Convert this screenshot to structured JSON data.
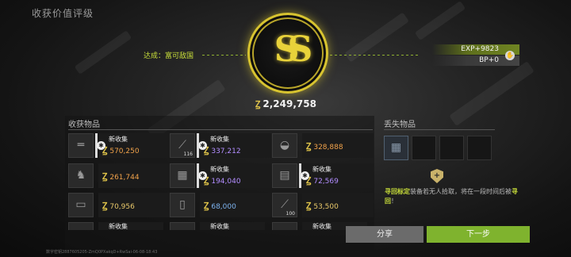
{
  "title": "收获价值评级",
  "achievement": {
    "label": "达成：富可敌国"
  },
  "emblem": {
    "letters": "SS"
  },
  "total_value": "2,249,758",
  "exp": {
    "exp_text": "EXP+9823",
    "bp_text": "BP+0"
  },
  "collected": {
    "title": "收获物品",
    "items": [
      {
        "icon": "rifle-icon",
        "glyph": "═",
        "count": "",
        "tag": "新收集",
        "value": "570,250",
        "quality": "orange",
        "gear": true
      },
      {
        "icon": "spear-icon",
        "glyph": "⟋",
        "count": "116",
        "tag": "新收集",
        "value": "337,212",
        "quality": "purple",
        "gear": true
      },
      {
        "icon": "golden-helmet-icon",
        "glyph": "◒",
        "count": "",
        "tag": "",
        "value": "328,888",
        "quality": "orange",
        "gear": false
      },
      {
        "icon": "golden-rabbit-icon",
        "glyph": "♞",
        "count": "",
        "tag": "",
        "value": "261,744",
        "quality": "orange",
        "gear": false
      },
      {
        "icon": "armor-vest-icon",
        "glyph": "▦",
        "count": "",
        "tag": "新收集",
        "value": "194,040",
        "quality": "purple",
        "gear": true
      },
      {
        "icon": "chest-rig-icon",
        "glyph": "▤",
        "count": "",
        "tag": "新收集",
        "value": "72,569",
        "quality": "purple",
        "gear": true
      },
      {
        "icon": "ammo-box-icon",
        "glyph": "▭",
        "count": "",
        "tag": "",
        "value": "70,956",
        "quality": "gold",
        "gear": false
      },
      {
        "icon": "document-icon",
        "glyph": "▯",
        "count": "",
        "tag": "",
        "value": "68,000",
        "quality": "blue",
        "gear": false
      },
      {
        "icon": "knife-icon",
        "glyph": "⟋",
        "count": "100",
        "tag": "",
        "value": "53,500",
        "quality": "gold",
        "gear": false
      }
    ],
    "partial_tags": [
      "新收集",
      "新收集",
      "新收集"
    ]
  },
  "lost": {
    "title": "丢失物品",
    "slots": [
      "body-armor-icon",
      "",
      "",
      ""
    ],
    "hint_bold_1": "寻回标定",
    "hint_mid": "装备若无人拾取，将在一段时间后被",
    "hint_bold_2": "寻回",
    "hint_end": "！"
  },
  "buttons": {
    "share": "分享",
    "next": "下一步"
  },
  "footer": "数字密钥2887605205-ZmQ0PXakqD+RwSai-06-08-18:43",
  "colors": {
    "accent_green": "#7fb32e",
    "gold": "#d8c430",
    "orange": "#f0a24a",
    "purple": "#b28dff",
    "blue": "#7eb4f0"
  }
}
